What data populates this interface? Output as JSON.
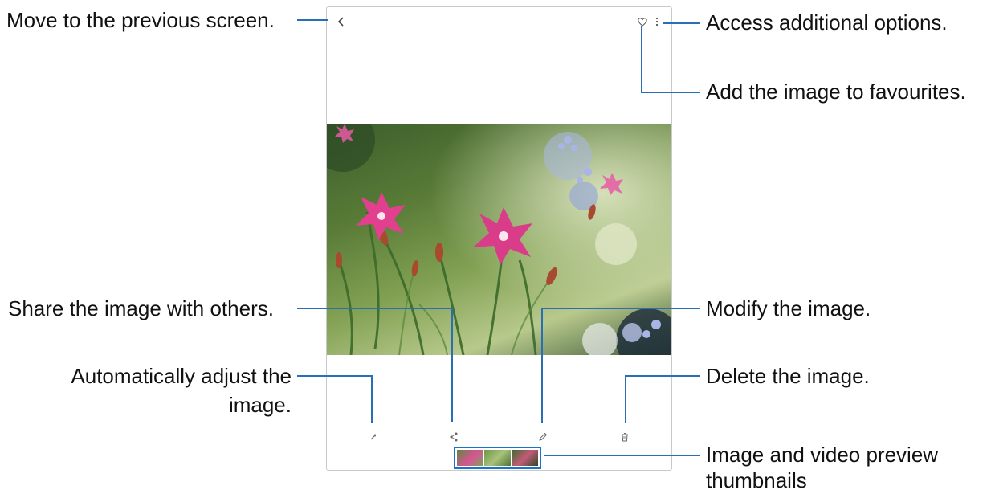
{
  "callouts": {
    "back": "Move to the previous screen.",
    "more": "Access additional options.",
    "favourite": "Add the image to favourites.",
    "share": "Share the image with others.",
    "auto_adjust_line1": "Automatically adjust the",
    "auto_adjust_line2": "image.",
    "edit": "Modify the image.",
    "delete": "Delete the image.",
    "thumbnails_line1": "Image and video preview",
    "thumbnails_line2": "thumbnails"
  },
  "icons": {
    "back": "chevron-left-icon",
    "favourite": "heart-icon",
    "more": "more-vertical-icon",
    "auto_adjust": "magic-wand-icon",
    "share": "share-icon",
    "edit": "pencil-icon",
    "delete": "trash-icon"
  },
  "colors": {
    "callout_line": "#2a6fb4",
    "thumbnail_highlight": "#1774c8",
    "flower": "#e2408f"
  }
}
